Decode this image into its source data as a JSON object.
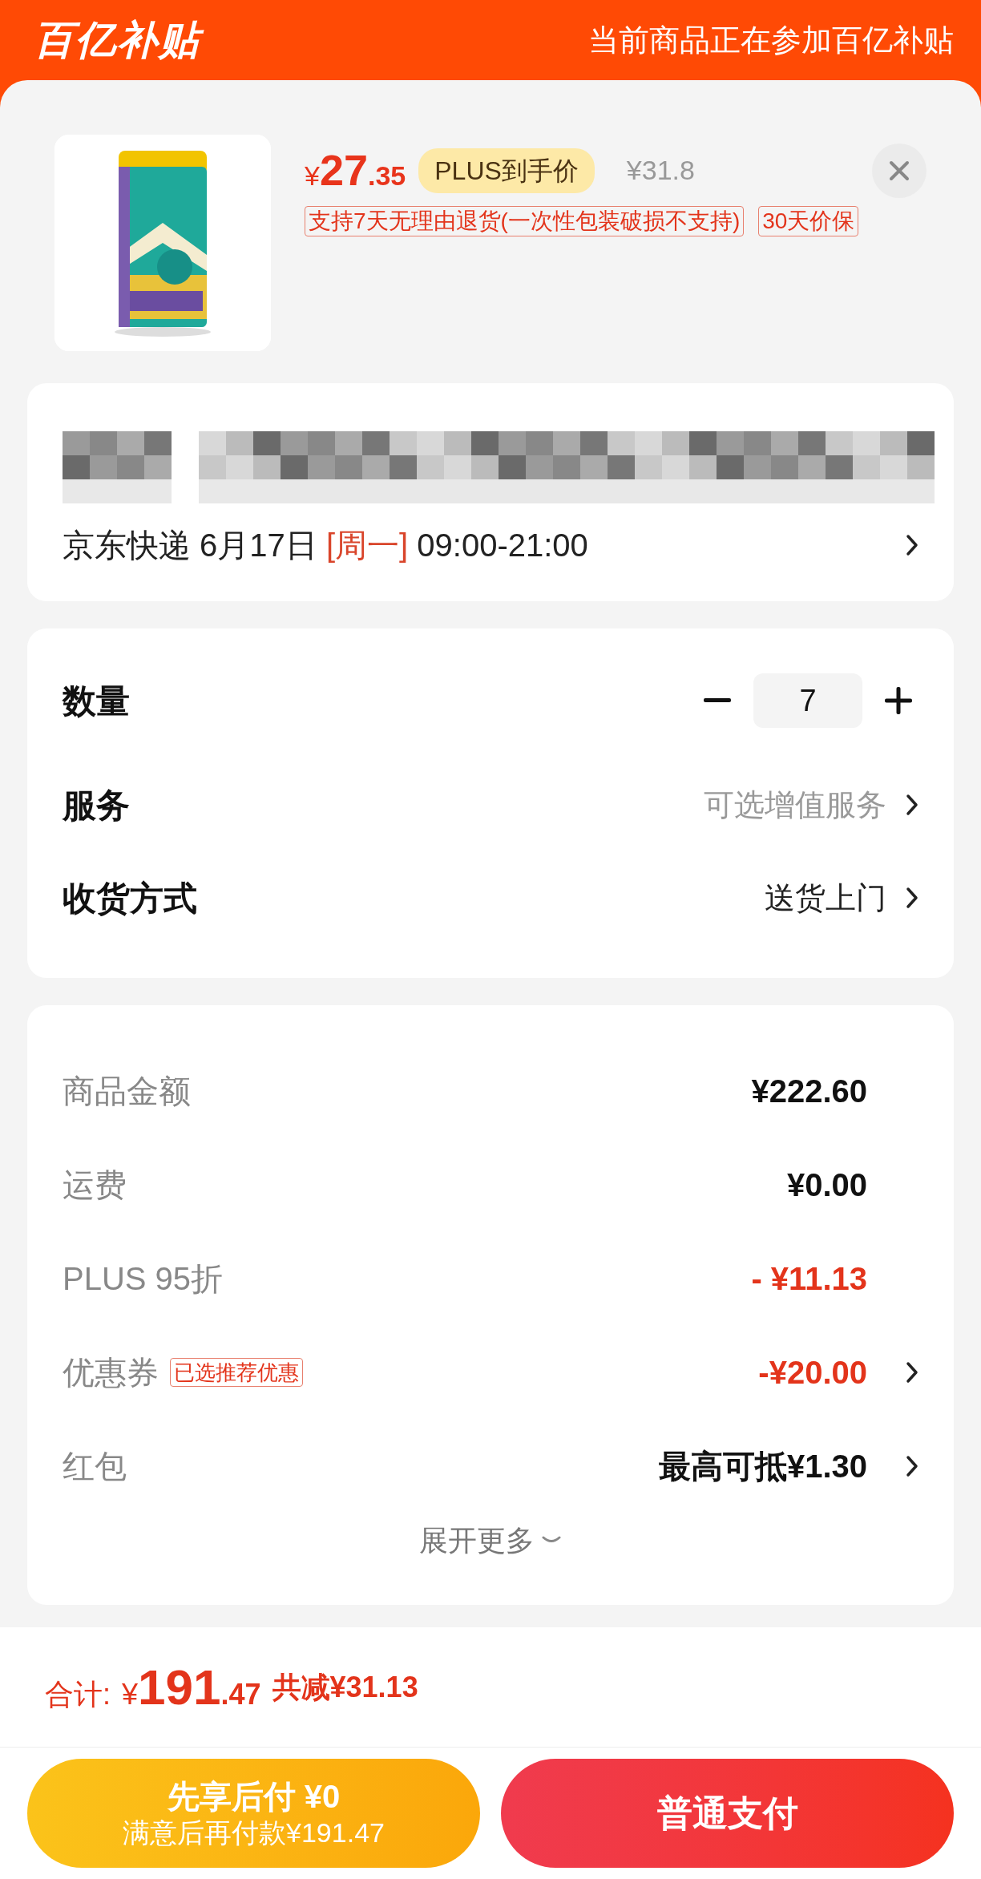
{
  "header": {
    "logo": "百亿补贴",
    "notice": "当前商品正在参加百亿补贴"
  },
  "product": {
    "kind": "picture",
    "price_symbol": "¥",
    "price_int": "27",
    "price_dec": ".35",
    "plus_badge": "PLUS到手价",
    "original_price": "¥31.8",
    "tags": [
      "支持7天无理由退货(一次性包装破损不支持)",
      "30天价保"
    ]
  },
  "delivery": {
    "carrier": "京东快递",
    "date": "6月17日",
    "weekday": "[周一]",
    "time": "09:00-21:00"
  },
  "quantity": {
    "label": "数量",
    "value": "7"
  },
  "options": [
    {
      "label": "服务",
      "value": "可选增值服务",
      "kind": "hint"
    },
    {
      "label": "收货方式",
      "value": "送货上门",
      "kind": "plain"
    }
  ],
  "costs": [
    {
      "label": "商品金额",
      "value": "¥222.60",
      "kind": "plain",
      "arrow": false
    },
    {
      "label": "运费",
      "value": "¥0.00",
      "kind": "plain",
      "arrow": false
    },
    {
      "label": "PLUS 95折",
      "value": "- ¥11.13",
      "kind": "discount",
      "arrow": false
    },
    {
      "label": "优惠券",
      "tag": "已选推荐优惠",
      "value": "-¥20.00",
      "kind": "discount",
      "arrow": true
    },
    {
      "label": "红包",
      "value": "最高可抵¥1.30",
      "kind": "plain",
      "arrow": true
    }
  ],
  "expand": "展开更多",
  "total": {
    "label": "合计:",
    "symbol": "¥",
    "int": "191",
    "dec": ".47",
    "saved": "共减¥31.13"
  },
  "buttons": [
    {
      "kind": "later",
      "title": "先享后付 ¥0",
      "subtitle": "满意后再付款¥191.47"
    },
    {
      "kind": "pay",
      "title": "普通支付"
    }
  ]
}
